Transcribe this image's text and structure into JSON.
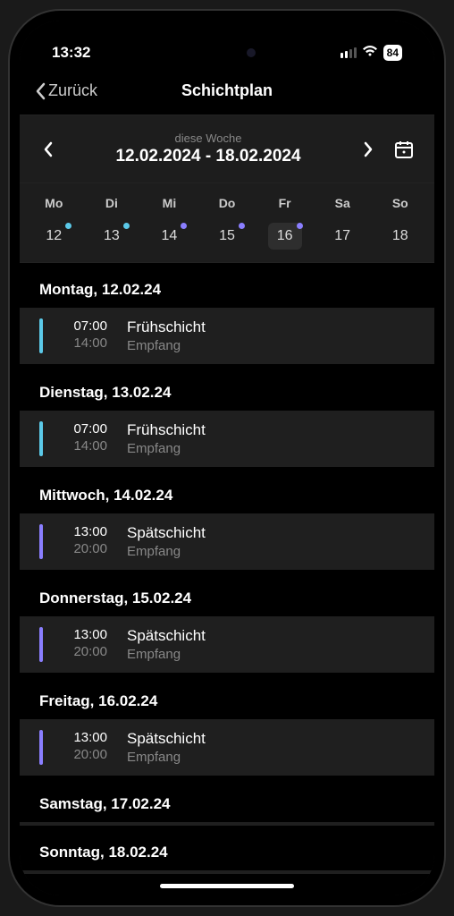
{
  "status": {
    "time": "13:32",
    "battery": "84"
  },
  "nav": {
    "back": "Zurück",
    "title": "Schichtplan"
  },
  "week": {
    "label": "diese Woche",
    "range": "12.02.2024 - 18.02.2024"
  },
  "days": [
    {
      "abbr": "Mo",
      "num": "12",
      "dot": "cyan",
      "today": false
    },
    {
      "abbr": "Di",
      "num": "13",
      "dot": "cyan",
      "today": false
    },
    {
      "abbr": "Mi",
      "num": "14",
      "dot": "purple",
      "today": false
    },
    {
      "abbr": "Do",
      "num": "15",
      "dot": "purple",
      "today": false
    },
    {
      "abbr": "Fr",
      "num": "16",
      "dot": "purple",
      "today": true
    },
    {
      "abbr": "Sa",
      "num": "17",
      "dot": "",
      "today": false
    },
    {
      "abbr": "So",
      "num": "18",
      "dot": "",
      "today": false
    }
  ],
  "sections": [
    {
      "title": "Montag, 12.02.24",
      "shifts": [
        {
          "start": "07:00",
          "end": "14:00",
          "name": "Frühschicht",
          "loc": "Empfang",
          "color": "cyan"
        }
      ]
    },
    {
      "title": "Dienstag, 13.02.24",
      "shifts": [
        {
          "start": "07:00",
          "end": "14:00",
          "name": "Frühschicht",
          "loc": "Empfang",
          "color": "cyan"
        }
      ]
    },
    {
      "title": "Mittwoch, 14.02.24",
      "shifts": [
        {
          "start": "13:00",
          "end": "20:00",
          "name": "Spätschicht",
          "loc": "Empfang",
          "color": "purple"
        }
      ]
    },
    {
      "title": "Donnerstag, 15.02.24",
      "shifts": [
        {
          "start": "13:00",
          "end": "20:00",
          "name": "Spätschicht",
          "loc": "Empfang",
          "color": "purple"
        }
      ]
    },
    {
      "title": "Freitag, 16.02.24",
      "shifts": [
        {
          "start": "13:00",
          "end": "20:00",
          "name": "Spätschicht",
          "loc": "Empfang",
          "color": "purple"
        }
      ]
    },
    {
      "title": "Samstag, 17.02.24",
      "shifts": []
    },
    {
      "title": "Sonntag, 18.02.24",
      "shifts": []
    }
  ]
}
